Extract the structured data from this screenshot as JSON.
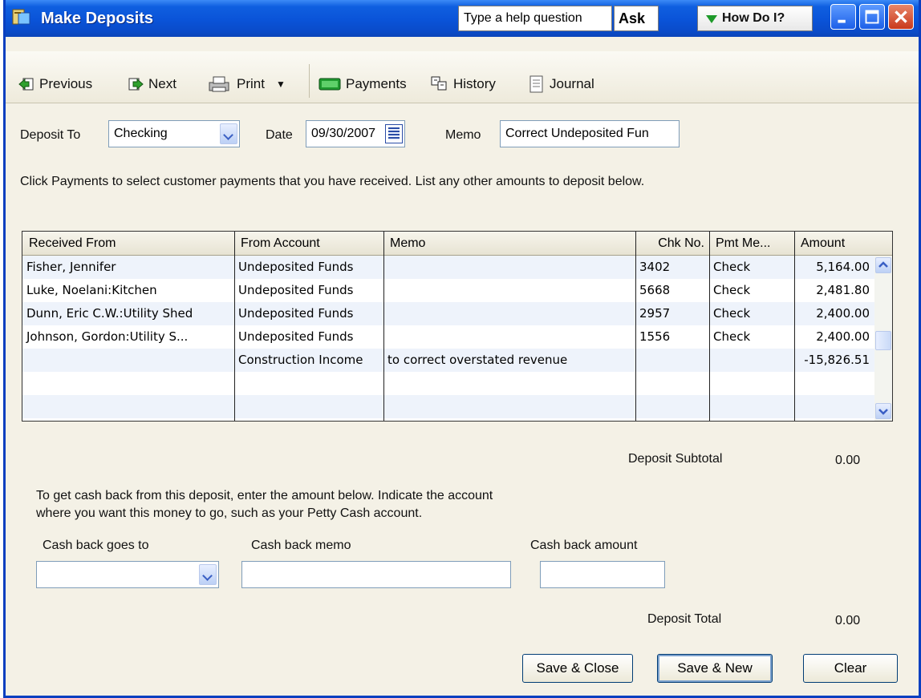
{
  "window": {
    "title": "Make Deposits",
    "help_placeholder": "Type a help question",
    "ask_label": "Ask",
    "how_do_i_label": "How Do I?"
  },
  "toolbar": {
    "previous": "Previous",
    "next": "Next",
    "print": "Print",
    "payments": "Payments",
    "history": "History",
    "journal": "Journal"
  },
  "header": {
    "deposit_to_label": "Deposit To",
    "deposit_to_value": "Checking",
    "date_label": "Date",
    "date_value": "09/30/2007",
    "memo_label": "Memo",
    "memo_value": "Correct Undeposited Fun"
  },
  "instructions": "Click Payments to select customer payments that you have received. List any other amounts to deposit below.",
  "grid": {
    "columns": [
      "Received From",
      "From Account",
      "Memo",
      "Chk No.",
      "Pmt Me...",
      "Amount"
    ],
    "rows": [
      {
        "received_from": "Fisher, Jennifer",
        "from_account": "Undeposited Funds",
        "memo": "",
        "chk_no": "3402",
        "pmt_method": "Check",
        "amount": "5,164.00"
      },
      {
        "received_from": "Luke, Noelani:Kitchen",
        "from_account": "Undeposited Funds",
        "memo": "",
        "chk_no": "5668",
        "pmt_method": "Check",
        "amount": "2,481.80"
      },
      {
        "received_from": "Dunn, Eric C.W.:Utility Shed",
        "from_account": "Undeposited Funds",
        "memo": "",
        "chk_no": "2957",
        "pmt_method": "Check",
        "amount": "2,400.00"
      },
      {
        "received_from": "Johnson, Gordon:Utility S...",
        "from_account": "Undeposited Funds",
        "memo": "",
        "chk_no": "1556",
        "pmt_method": "Check",
        "amount": "2,400.00"
      },
      {
        "received_from": "",
        "from_account": "Construction Income",
        "memo": "to correct overstated revenue",
        "chk_no": "",
        "pmt_method": "",
        "amount": "-15,826.51"
      },
      {
        "received_from": "",
        "from_account": "",
        "memo": "",
        "chk_no": "",
        "pmt_method": "",
        "amount": ""
      },
      {
        "received_from": "",
        "from_account": "",
        "memo": "",
        "chk_no": "",
        "pmt_method": "",
        "amount": ""
      }
    ]
  },
  "subtotal": {
    "label": "Deposit Subtotal",
    "value": "0.00"
  },
  "cash_back": {
    "instructions_line1": "To get cash back from this deposit, enter the amount below.  Indicate the account",
    "instructions_line2": "where you want this money to go, such as your Petty Cash account.",
    "goes_to_label": "Cash back goes to",
    "goes_to_value": "",
    "memo_label": "Cash back memo",
    "memo_value": "",
    "amount_label": "Cash back amount",
    "amount_value": ""
  },
  "total": {
    "label": "Deposit Total",
    "value": "0.00"
  },
  "buttons": {
    "save_close": "Save & Close",
    "save_new": "Save & New",
    "clear": "Clear"
  },
  "colors": {
    "titlebar": "#0a53d8",
    "dialog_bg": "#f4f1e6",
    "accent_green": "#1e9a2a",
    "close_red": "#c9391c"
  }
}
